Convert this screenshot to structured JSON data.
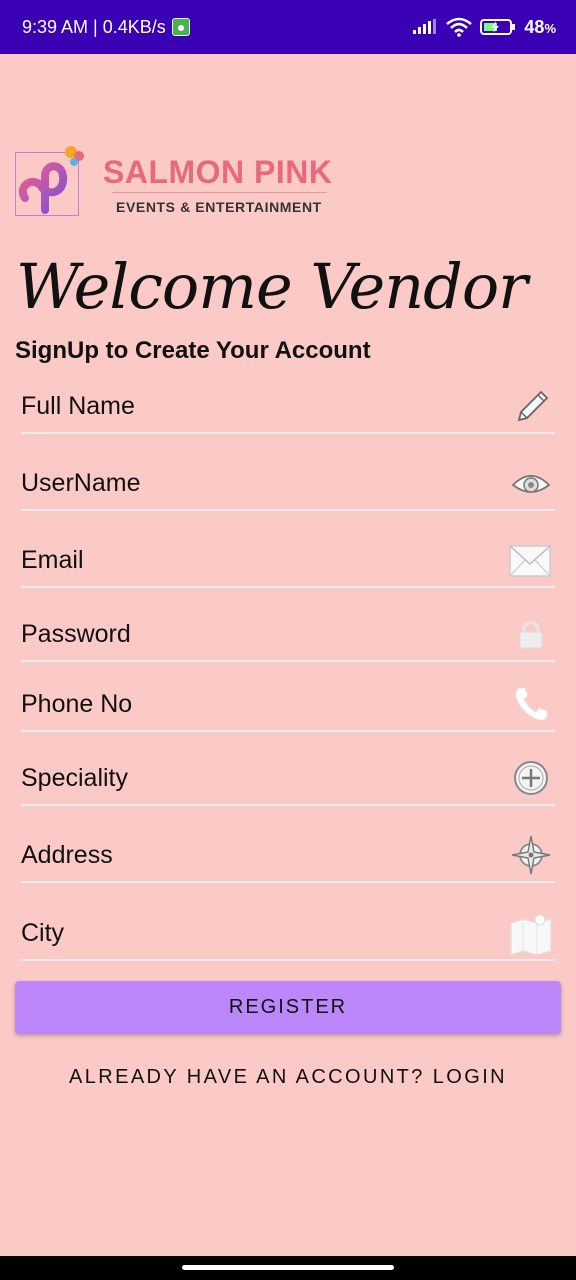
{
  "status_bar": {
    "time_speed": "9:39 AM | 0.4KB/s",
    "battery": "48",
    "battery_unit": "%"
  },
  "brand": {
    "name": "SALMON PINK",
    "tagline": "EVENTS & ENTERTAINMENT"
  },
  "header": {
    "welcome": "Welcome Vendor",
    "subtitle": "SignUp to Create Your Account"
  },
  "form": {
    "fields": [
      {
        "label": "Full Name",
        "icon": "pencil-icon"
      },
      {
        "label": "UserName",
        "icon": "eye-icon"
      },
      {
        "label": "Email",
        "icon": "envelope-icon"
      },
      {
        "label": "Password",
        "icon": "lock-icon"
      },
      {
        "label": "Phone No",
        "icon": "phone-icon"
      },
      {
        "label": "Speciality",
        "icon": "plus-circle-icon"
      },
      {
        "label": "Address",
        "icon": "compass-icon"
      },
      {
        "label": "City",
        "icon": "map-icon"
      }
    ],
    "register_label": "REGISTER",
    "login_link": "ALREADY HAVE AN ACCOUNT? LOGIN"
  },
  "colors": {
    "background": "#FCCAC6",
    "status_bar": "#3A00B3",
    "button": "#BC87FA",
    "brand_pink": "#E8697A"
  }
}
